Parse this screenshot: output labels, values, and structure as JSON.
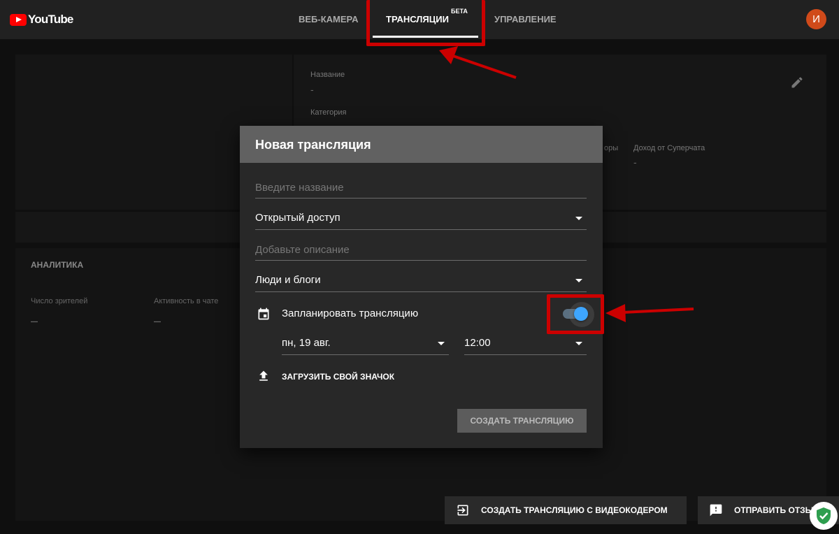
{
  "topbar": {
    "logo_text": "YouTube",
    "tabs": [
      {
        "label": "ВЕБ-КАМЕРА"
      },
      {
        "label": "ТРАНСЛЯЦИИ",
        "badge": "БЕТА"
      },
      {
        "label": "УПРАВЛЕНИЕ"
      }
    ],
    "avatar_letter": "И"
  },
  "info_panel": {
    "name_label": "Название",
    "name_value": "-",
    "category_label": "Категория",
    "viewers_label_partial": "оры",
    "superchat_label": "Доход от Суперчата",
    "superchat_value": "-"
  },
  "analytics": {
    "title": "АНАЛИТИКА",
    "viewers_label": "Число зрителей",
    "viewers_value": "–",
    "chat_label": "Активность в чате",
    "chat_value": "–"
  },
  "dialog": {
    "title": "Новая трансляция",
    "name_placeholder": "Введите название",
    "privacy_value": "Открытый доступ",
    "description_placeholder": "Добавьте описание",
    "category_value": "Люди и блоги",
    "schedule_label": "Запланировать трансляцию",
    "schedule_enabled": true,
    "date_value": "пн, 19 авг.",
    "time_value": "12:00",
    "upload_label": "ЗАГРУЗИТЬ СВОЙ ЗНАЧОК",
    "create_button": "СОЗДАТЬ ТРАНСЛЯЦИЮ"
  },
  "bottom": {
    "encoder_button": "СОЗДАТЬ ТРАНСЛЯЦИЮ С ВИДЕОКОДЕРОМ",
    "feedback_button": "ОТПРАВИТЬ ОТЗЫВ"
  },
  "icons": {
    "calendar": "calendar-icon",
    "upload": "upload-icon",
    "edit": "pencil-icon",
    "encoder": "exit-to-app-icon",
    "feedback": "feedback-icon",
    "shield": "shield-check-icon"
  },
  "colors": {
    "accent": "#3ea6ff",
    "brand": "#ff0000",
    "annotation": "#cc0000"
  }
}
